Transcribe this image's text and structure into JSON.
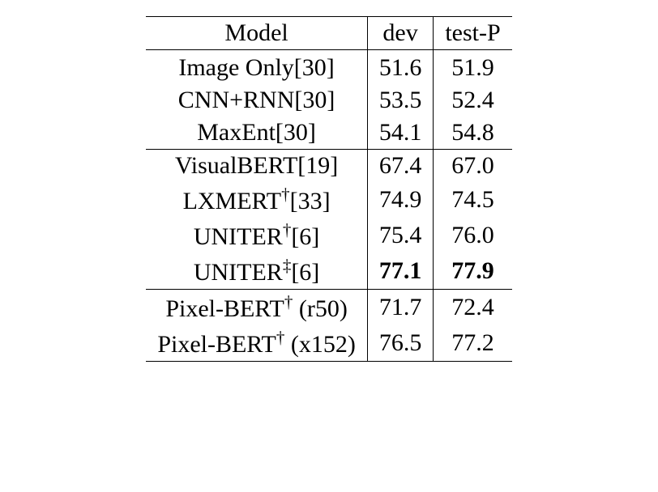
{
  "chart_data": {
    "type": "table",
    "columns": [
      "Model",
      "dev",
      "test-P"
    ],
    "sections": [
      {
        "rows": [
          {
            "model": "Image Only[30]",
            "dev": "51.6",
            "test": "51.9"
          },
          {
            "model": "CNN+RNN[30]",
            "dev": "53.5",
            "test": "52.4"
          },
          {
            "model": "MaxEnt[30]",
            "dev": "54.1",
            "test": "54.8"
          }
        ]
      },
      {
        "rows": [
          {
            "model": "VisualBERT[19]",
            "dev": "67.4",
            "test": "67.0"
          },
          {
            "model_html": "LXMERT<sup>†</sup>[33]",
            "dev": "74.9",
            "test": "74.5"
          },
          {
            "model_html": "UNITER<sup>†</sup>[6]",
            "dev": "75.4",
            "test": "76.0"
          },
          {
            "model_html": "UNITER<sup>‡</sup>[6]",
            "dev": "77.1",
            "test": "77.9",
            "bold": true
          }
        ]
      },
      {
        "rows": [
          {
            "model_html": "Pixel-BERT<sup>†</sup> (r50)",
            "dev": "71.7",
            "test": "72.4"
          },
          {
            "model_html": "Pixel-BERT<sup>†</sup> (x152)",
            "dev": "76.5",
            "test": "77.2"
          }
        ]
      }
    ]
  }
}
